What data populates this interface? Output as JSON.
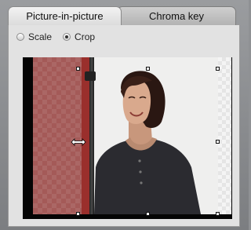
{
  "tabs": {
    "active_label": "Picture-in-picture",
    "inactive_label": "Chroma key"
  },
  "mode": {
    "options": [
      {
        "label": "Scale",
        "selected": false
      },
      {
        "label": "Crop",
        "selected": true
      }
    ]
  },
  "preview": {
    "handles": [
      "top-left",
      "top-center",
      "top-right",
      "middle-left",
      "middle-right",
      "bottom-left",
      "bottom-center",
      "bottom-right"
    ],
    "cursor_icon": "horizontal-resize-cursor-icon"
  },
  "colors": {
    "panel_bg": "#e2e2e2",
    "frame": "#050505",
    "cropped_region": "#a45a58"
  }
}
